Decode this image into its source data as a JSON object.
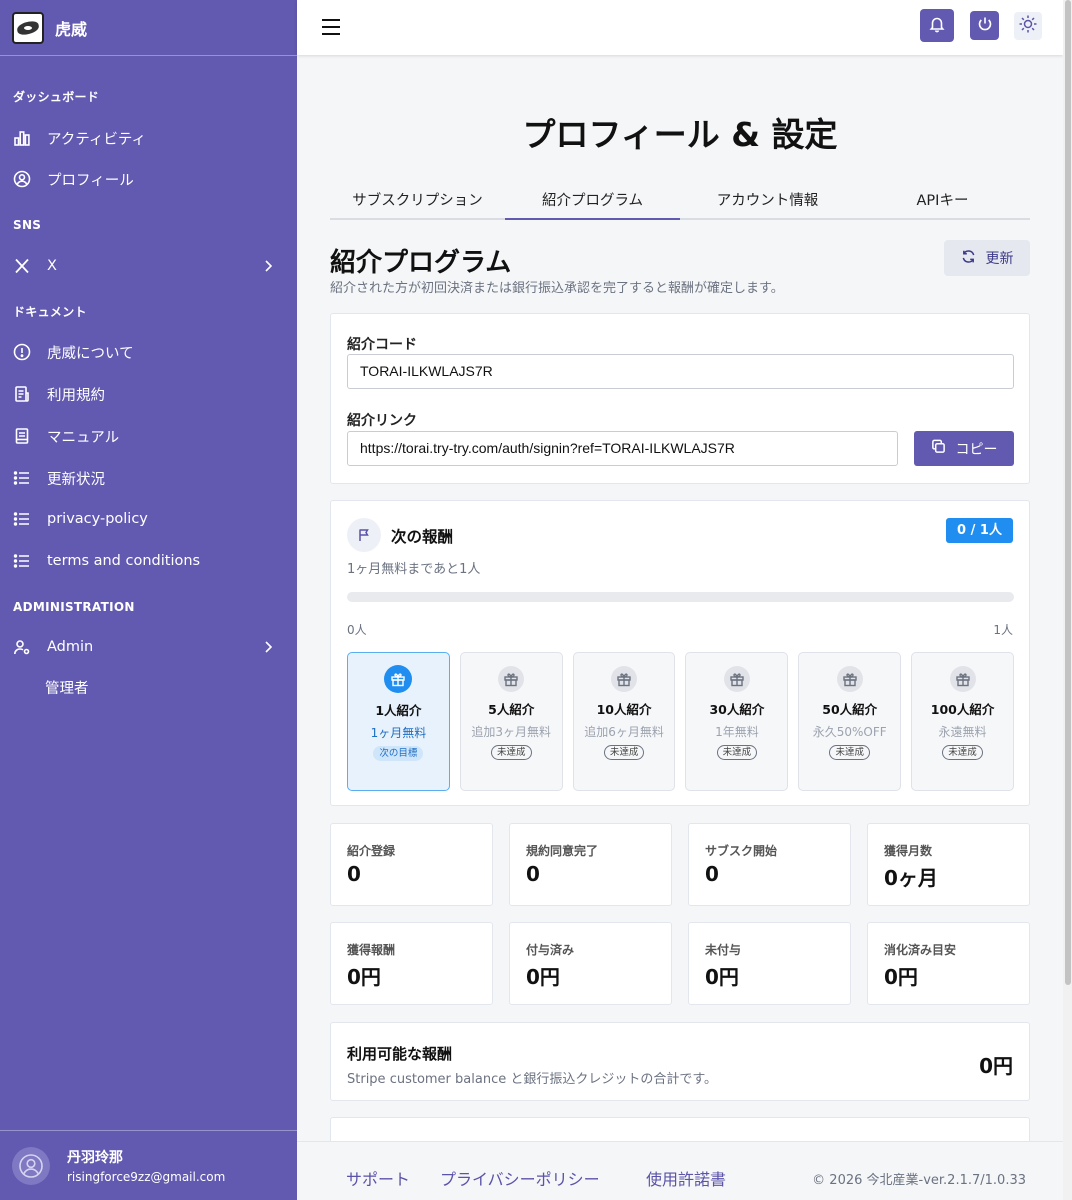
{
  "brand": {
    "name": "虎威"
  },
  "sidebar": {
    "sections": [
      "ダッシュボード",
      "SNS",
      "ドキュメント",
      "ADMINISTRATION"
    ],
    "items": [
      {
        "label": "アクティビティ",
        "icon": "bar-chart-icon"
      },
      {
        "label": "プロフィール",
        "icon": "user-circle-icon"
      },
      {
        "label": "X",
        "icon": "x-logo-icon"
      },
      {
        "label": "虎威について",
        "icon": "info-circle-icon"
      },
      {
        "label": "利用規約",
        "icon": "document-icon"
      },
      {
        "label": "マニュアル",
        "icon": "book-icon"
      },
      {
        "label": "更新状況",
        "icon": "list-icon"
      },
      {
        "label": "privacy-policy",
        "icon": "list-icon"
      },
      {
        "label": "terms and conditions",
        "icon": "list-icon"
      },
      {
        "label": "Admin",
        "icon": "user-gear-icon"
      }
    ],
    "admin_sub": "管理者",
    "user": {
      "name": "丹羽玲那",
      "email": "risingforce9zz@gmail.com"
    }
  },
  "page": {
    "title": "プロフィール & 設定",
    "tabs": [
      "サブスクリプション",
      "紹介プログラム",
      "アカウント情報",
      "APIキー"
    ],
    "active_tab": 1
  },
  "referral": {
    "title": "紹介プログラム",
    "description": "紹介された方が初回決済または銀行振込承認を完了すると報酬が確定します。",
    "refresh_label": "更新",
    "code_label": "紹介コード",
    "code_value": "TORAI-ILKWLAJS7R",
    "link_label": "紹介リンク",
    "link_value": "https://torai.try-try.com/auth/signin?ref=TORAI-ILKWLAJS7R",
    "copy_label": "コピー"
  },
  "next_reward": {
    "title": "次の報酬",
    "badge": "0 / 1人",
    "subtitle": "1ヶ月無料まであと1人",
    "progress": 0,
    "min_label": "0人",
    "max_label": "1人",
    "tiers": [
      {
        "name": "1人紹介",
        "reward": "1ヶ月無料",
        "status": "次の目標"
      },
      {
        "name": "5人紹介",
        "reward": "追加3ヶ月無料",
        "status": "未達成"
      },
      {
        "name": "10人紹介",
        "reward": "追加6ヶ月無料",
        "status": "未達成"
      },
      {
        "name": "30人紹介",
        "reward": "1年無料",
        "status": "未達成"
      },
      {
        "name": "50人紹介",
        "reward": "永久50%OFF",
        "status": "未達成"
      },
      {
        "name": "100人紹介",
        "reward": "永遠無料",
        "status": "未達成"
      }
    ]
  },
  "stats": [
    {
      "label": "紹介登録",
      "value": "0"
    },
    {
      "label": "規約同意完了",
      "value": "0"
    },
    {
      "label": "サブスク開始",
      "value": "0"
    },
    {
      "label": "獲得月数",
      "value": "0ヶ月"
    },
    {
      "label": "獲得報酬",
      "value": "0円"
    },
    {
      "label": "付与済み",
      "value": "0円"
    },
    {
      "label": "未付与",
      "value": "0円"
    },
    {
      "label": "消化済み目安",
      "value": "0円"
    }
  ],
  "available": {
    "title": "利用可能な報酬",
    "description": "Stripe customer balance と銀行振込クレジットの合計です。",
    "value": "0円"
  },
  "footer": {
    "links": [
      "サポート",
      "プライバシーポリシー",
      "使用許諾書"
    ],
    "copyright": "© 2026 今北産業-ver.2.1.7/1.0.33"
  },
  "colors": {
    "brand": "#6259b0",
    "accent": "#1f8ef0"
  }
}
